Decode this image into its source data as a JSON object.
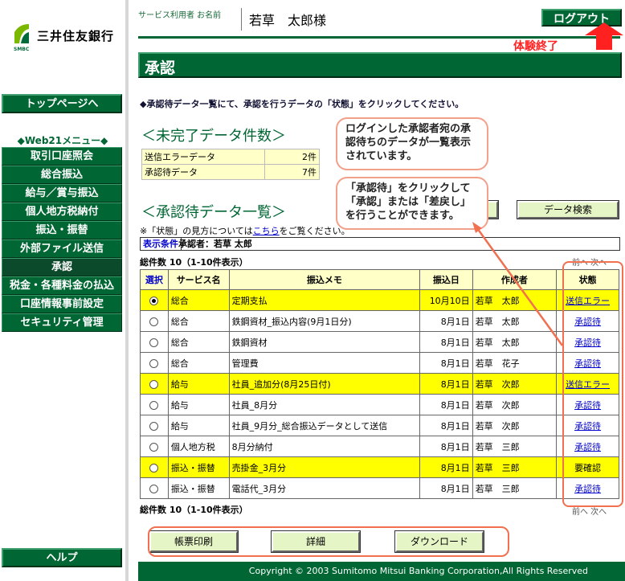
{
  "sidebar": {
    "logo_text": "三井住友銀行",
    "logo_sub": "SMBC",
    "top_button": "トップページへ",
    "menu_title": "◆Web21メニュー◆",
    "items": [
      "取引口座照会",
      "総合振込",
      "給与／賞与振込",
      "個人地方税納付",
      "振込・振替",
      "外部ファイル送信",
      "承認",
      "税金・各種料金の払込",
      "口座情報事前設定",
      "セキュリティ管理"
    ],
    "help_button": "ヘルプ"
  },
  "header": {
    "user_label": "サービス利用者 お名前",
    "user_name": "若草　太郎様",
    "logout": "ログアウト",
    "end_label": "体験終了"
  },
  "page_title": "承認",
  "instruction": "◆承認待データ一覧にて、承認を行うデータの「状態」をクリックしてください。",
  "summary": {
    "title": "＜未完了データ件数＞",
    "rows": [
      {
        "label": "送信エラーデータ",
        "count": "2件"
      },
      {
        "label": "承認待データ",
        "count": "7件"
      }
    ]
  },
  "callouts": {
    "first": "ログインした承認者宛の承認待ちのデータが一覧表示されています。",
    "second": "「承認待」をクリックして「承認」または「差戻し」を行うことができます。"
  },
  "list": {
    "title": "＜承認待データ一覧＞",
    "search_button": "データ検索",
    "note_before": "※「状態」の見方については",
    "note_link": "こちら",
    "note_after": "をご覧ください。",
    "cond_key": "表示条件",
    "cond_value": "承認者：若草 太郎",
    "total_top": "総件数 10（1-10件表示）",
    "total_bottom": "総件数 10（1-10件表示）",
    "pager_top": "前へ 次へ",
    "pager_bottom": "前へ 次へ",
    "headers": [
      "選択",
      "サービス名",
      "振込メモ",
      "振込日",
      "作成者",
      "状態"
    ],
    "rows": [
      {
        "service": "総合",
        "memo": "定期支払",
        "date": "10月10日",
        "creator": "若草　太郎",
        "status": "送信エラー",
        "highlight": true,
        "selected": true
      },
      {
        "service": "総合",
        "memo": "鉄鋼資材_振込内容(9月1日分)",
        "date": "8月1日",
        "creator": "若草　太郎",
        "status": "承認待",
        "highlight": false,
        "selected": false
      },
      {
        "service": "総合",
        "memo": "鉄鋼資材",
        "date": "8月1日",
        "creator": "若草　太郎",
        "status": "承認待",
        "highlight": false,
        "selected": false
      },
      {
        "service": "総合",
        "memo": "管理費",
        "date": "8月1日",
        "creator": "若草　花子",
        "status": "承認待",
        "highlight": false,
        "selected": false
      },
      {
        "service": "給与",
        "memo": "社員_追加分(8月25日付)",
        "date": "8月1日",
        "creator": "若草　次郎",
        "status": "送信エラー",
        "highlight": true,
        "selected": false
      },
      {
        "service": "給与",
        "memo": "社員_8月分",
        "date": "8月1日",
        "creator": "若草　次郎",
        "status": "承認待",
        "highlight": false,
        "selected": false
      },
      {
        "service": "給与",
        "memo": "社員_9月分_総合振込データとして送信",
        "date": "8月1日",
        "creator": "若草　次郎",
        "status": "承認待",
        "highlight": false,
        "selected": false
      },
      {
        "service": "個人地方税",
        "memo": "8月分納付",
        "date": "8月1日",
        "creator": "若草　三郎",
        "status": "承認待",
        "highlight": false,
        "selected": false
      },
      {
        "service": "振込・振替",
        "memo": "売掛金_3月分",
        "date": "8月1日",
        "creator": "若草　三郎",
        "status": "要確認",
        "highlight": true,
        "selected": false
      },
      {
        "service": "振込・振替",
        "memo": "電話代_3月分",
        "date": "8月1日",
        "creator": "若草　三郎",
        "status": "承認待",
        "highlight": false,
        "selected": false
      }
    ]
  },
  "buttons": {
    "print": "帳票印刷",
    "detail": "詳細",
    "download": "ダウンロード"
  },
  "footer": "Copyright © 2003 Sumitomo Mitsui Banking Corporation,All Rights Reserved",
  "colors": {
    "brand_green": "#006633",
    "highlight_yellow": "#ffff00",
    "annotation_orange": "#f07050"
  }
}
